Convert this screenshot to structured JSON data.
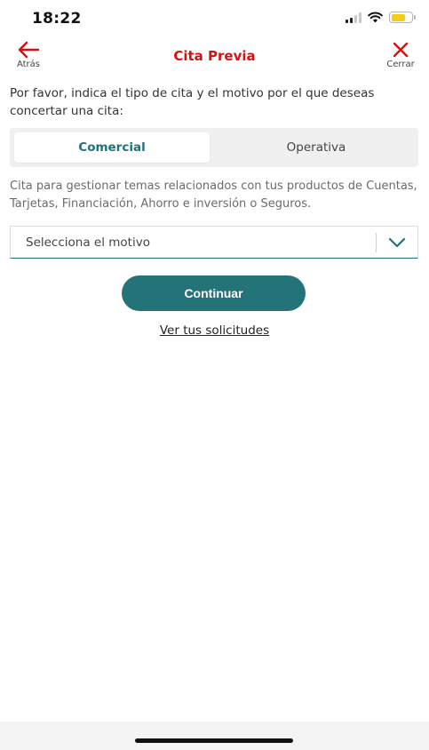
{
  "status_bar": {
    "time": "18:22",
    "icons": [
      "signal-icon",
      "wifi-icon",
      "battery-icon"
    ],
    "battery_color": "#f6cc15"
  },
  "nav": {
    "back_label": "Atrás",
    "back_icon": "arrow-left-icon",
    "title": "Cita Previa",
    "close_label": "Cerrar",
    "close_icon": "close-icon",
    "accent_color": "#d60f0f"
  },
  "intro_text": "Por favor, indica el tipo de cita y el motivo por el que deseas concertar una cita:",
  "appointment_type": {
    "options": [
      "Comercial",
      "Operativa"
    ],
    "selected": "Comercial"
  },
  "description": "Cita para gestionar temas relacionados con tus productos de Cuentas, Tarjetas, Financiación, Ahorro e inversión o Seguros.",
  "reason_select": {
    "value": "Selecciona el motivo",
    "icon": "chevron-down-icon"
  },
  "actions": {
    "continue_label": "Continuar",
    "requests_link": "Ver tus solicitudes",
    "primary_color": "#237378"
  }
}
